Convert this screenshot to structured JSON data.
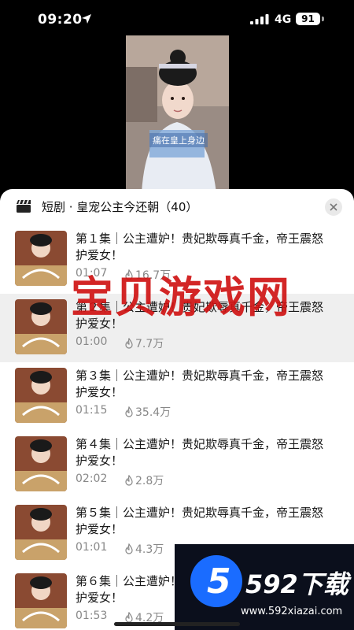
{
  "status_bar": {
    "time": "09:20",
    "network": "4G",
    "battery": "91"
  },
  "video": {
    "subtitle": "痛在皇上身边"
  },
  "sheet": {
    "title": "短剧 · 皇宠公主今还朝（40）"
  },
  "episodes": [
    {
      "title": "第１集｜公主遭妒！贵妃欺辱真千金，帝王震怒护爱女！",
      "duration": "01:07",
      "views": "16.7万"
    },
    {
      "title": "第２集｜公主遭妒！贵妃欺辱真千金，帝王震怒护爱女！",
      "duration": "01:00",
      "views": "7.7万"
    },
    {
      "title": "第３集｜公主遭妒！贵妃欺辱真千金，帝王震怒护爱女！",
      "duration": "01:15",
      "views": "35.4万"
    },
    {
      "title": "第４集｜公主遭妒！贵妃欺辱真千金，帝王震怒护爱女！",
      "duration": "02:02",
      "views": "2.8万"
    },
    {
      "title": "第５集｜公主遭妒！贵妃欺辱真千金，帝王震怒护爱女！",
      "duration": "01:01",
      "views": "4.3万"
    },
    {
      "title": "第６集｜公主遭妒！贵妃欺辱真千金，帝王震怒护爱女！",
      "duration": "01:53",
      "views": "4.2万"
    }
  ],
  "watermark": {
    "text": "宝贝游戏网"
  },
  "logo": {
    "digit": "5",
    "text": "592下载",
    "url": "www.592xiazai.com"
  },
  "colors": {
    "accent_red": "#d01414",
    "logo_blue": "#1a6cff"
  }
}
